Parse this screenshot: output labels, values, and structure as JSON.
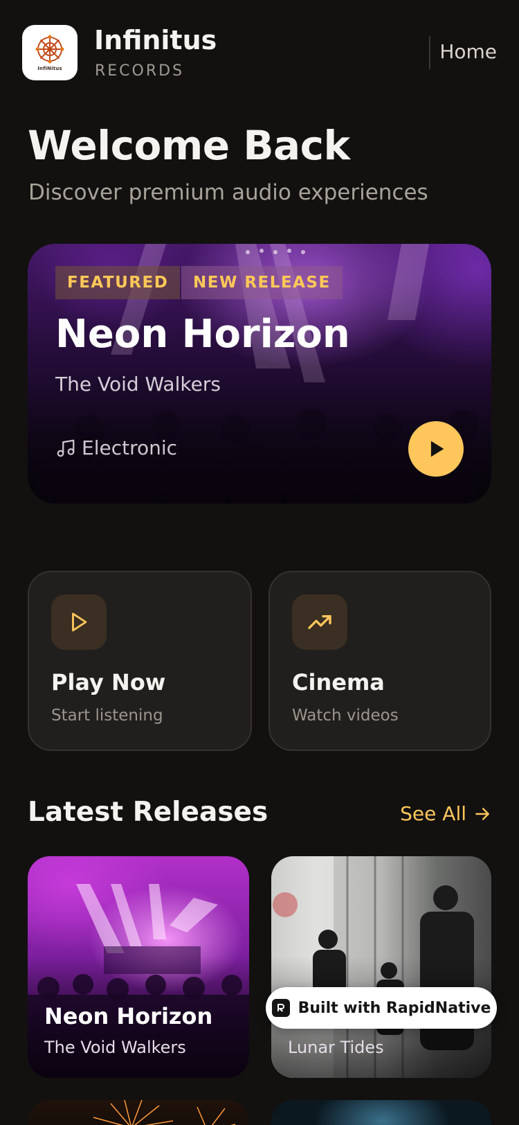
{
  "header": {
    "logo_text": "InfiNitus",
    "brand_name": "Infinitus",
    "brand_sub": "RECORDS",
    "nav_home": "Home"
  },
  "welcome": {
    "title": "Welcome Back",
    "subtitle": "Discover premium audio experiences"
  },
  "featured": {
    "tags": [
      "FEATURED",
      "NEW RELEASE"
    ],
    "title": "Neon Horizon",
    "artist": "The Void Walkers",
    "genre": "Electronic",
    "genre_icon": "music-note-icon",
    "play_icon": "play-icon"
  },
  "quick_actions": [
    {
      "title": "Play Now",
      "subtitle": "Start listening",
      "icon": "play-outline-icon"
    },
    {
      "title": "Cinema",
      "subtitle": "Watch videos",
      "icon": "trending-up-icon"
    }
  ],
  "latest": {
    "title": "Latest Releases",
    "see_all": "See All",
    "items": [
      {
        "title": "Neon Horizon",
        "artist": "The Void Walkers"
      },
      {
        "title": "",
        "artist": "Lunar Tides"
      }
    ]
  },
  "badge": {
    "label": "Built with RapidNative"
  },
  "colors": {
    "background": "#121110",
    "accent": "#ffc65c",
    "card": "#211f1d",
    "text_primary": "#f5f3ef",
    "text_secondary": "#a9a39b"
  }
}
